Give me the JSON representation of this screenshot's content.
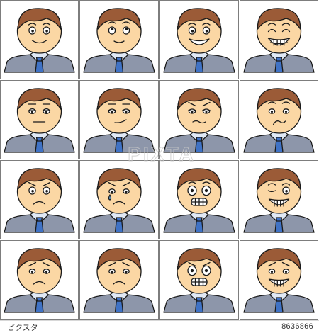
{
  "footer": {
    "logo_text": "ピクスタ",
    "stock_id": "8636866"
  },
  "watermark": {
    "text": "PIXTA"
  },
  "colors": {
    "skin": "#fbd7a4",
    "hair": "#9b5b37",
    "suit": "#8d96aa",
    "shirt": "#dfe8f5",
    "tie": "#3f72c5",
    "grid_line": "#7d7d7d"
  },
  "faces": [
    {
      "expression": "smile"
    },
    {
      "expression": "thinking"
    },
    {
      "expression": "grin"
    },
    {
      "expression": "laughing"
    },
    {
      "expression": "neutral"
    },
    {
      "expression": "smug"
    },
    {
      "expression": "tired"
    },
    {
      "expression": "doubtful"
    },
    {
      "expression": "sad"
    },
    {
      "expression": "crying"
    },
    {
      "expression": "scared"
    },
    {
      "expression": "wink"
    },
    {
      "expression": "displeased"
    },
    {
      "expression": "angry"
    },
    {
      "expression": "frightened"
    },
    {
      "expression": "sly"
    }
  ]
}
